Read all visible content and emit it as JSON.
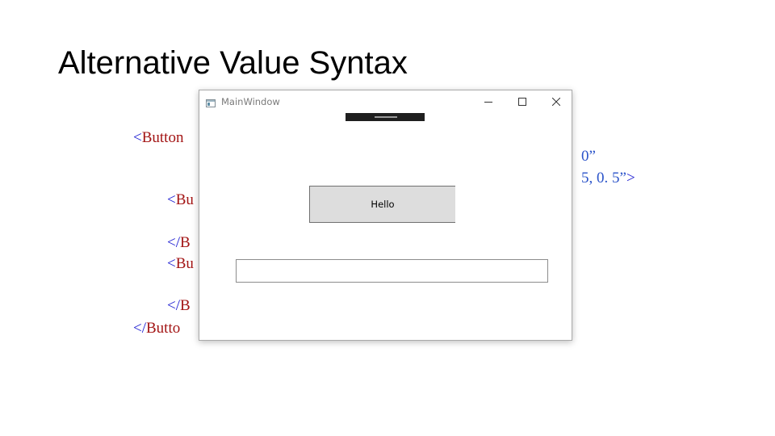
{
  "slide": {
    "title": "Alternative Value Syntax"
  },
  "code_left": [
    {
      "angle": "<",
      "tag": "Button"
    },
    {
      "angle": "<",
      "tag": "Bu"
    },
    {
      "angle": "</",
      "tag": "B"
    },
    {
      "angle": "<",
      "tag": "Bu"
    },
    {
      "angle": "</",
      "tag": "B"
    },
    {
      "angle": "</",
      "tag": "Butto"
    }
  ],
  "code_right": [
    {
      "text": "0”"
    },
    {
      "text": "5, 0. 5”",
      "angle": ">"
    }
  ],
  "window": {
    "title": "MainWindow",
    "hello_label": "Hello",
    "textbox_value": ""
  },
  "colors": {
    "code_tag": "#a31515",
    "code_angle": "#1f1fd2",
    "code_attr": "#2a53c9",
    "button_bg": "#dddddd"
  }
}
